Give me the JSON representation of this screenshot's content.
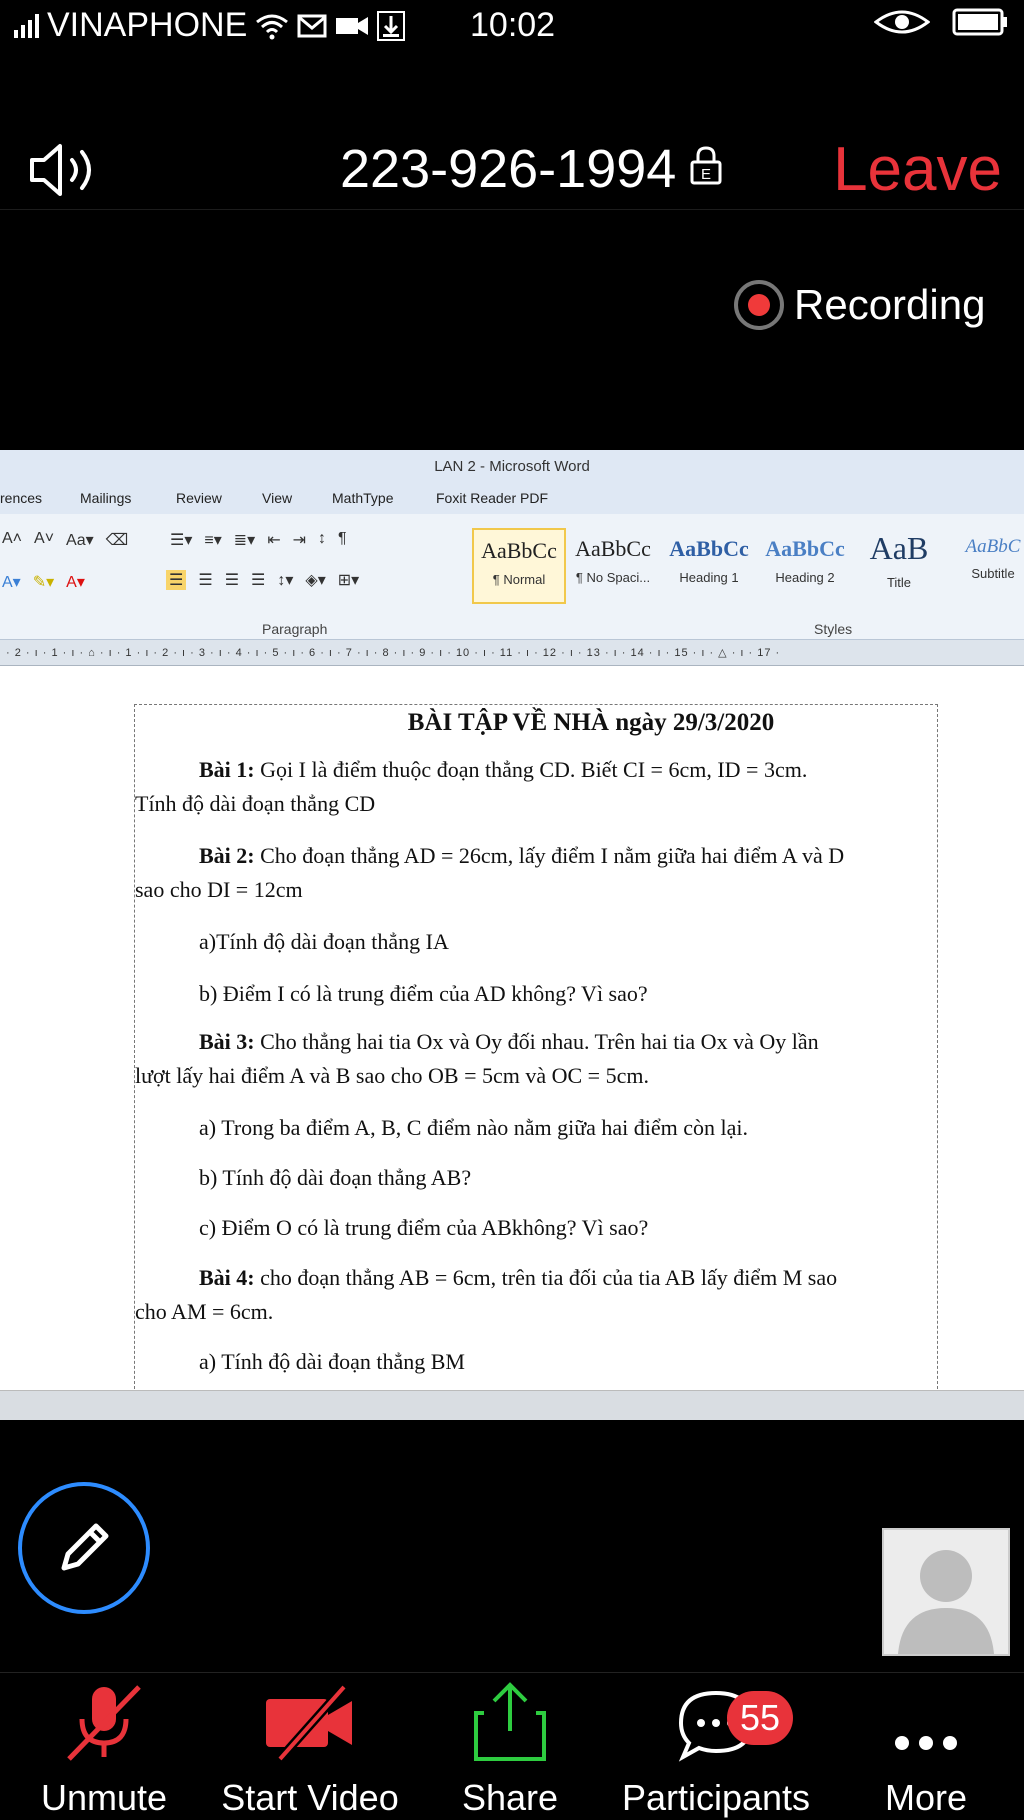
{
  "status_bar": {
    "carrier": "VINAPHONE",
    "time": "10:02",
    "icons": [
      "signal-icon",
      "wifi-icon",
      "mail-icon",
      "video-camera-icon",
      "download-icon",
      "eye-icon",
      "battery-icon"
    ]
  },
  "meeting": {
    "id": "223-926-1994",
    "lock_letter": "E",
    "leave_label": "Leave",
    "recording_label": "Recording",
    "colors": {
      "leave": "#e8333a",
      "record_dot": "#f03a3a",
      "annotate_ring": "#2d8cff",
      "share_green": "#2ecc40"
    }
  },
  "word": {
    "window_title": "LAN 2  -  Microsoft Word",
    "tabs": [
      "rences",
      "Mailings",
      "Review",
      "View",
      "MathType",
      "Foxit Reader PDF"
    ],
    "groups": {
      "paragraph": "Paragraph",
      "styles": "Styles"
    },
    "styles": [
      {
        "sample": "AaBbCc",
        "name": "¶ Normal"
      },
      {
        "sample": "AaBbCc",
        "name": "¶ No Spaci..."
      },
      {
        "sample": "AaBbCc",
        "name": "Heading 1"
      },
      {
        "sample": "AaBbCc",
        "name": "Heading 2"
      },
      {
        "sample": "AaB",
        "name": "Title"
      },
      {
        "sample": "AaBbC",
        "name": "Subtitle"
      }
    ],
    "ruler": "· 2 · ı · 1 · ı · ⌂ · ı · 1 · ı · 2 · ı · 3 · ı · 4 · ı · 5 · ı · 6 · ı · 7 · ı · 8 · ı · 9 · ı · 10 · ı · 11 · ı · 12 · ı · 13 · ı · 14 · ı · 15 · ı · △ · ı · 17 ·"
  },
  "document": {
    "title": "BÀI TẬP VỀ NHÀ ngày 29/3/2020",
    "b1_label": "Bài 1:",
    "b1_text": " Gọi I là điểm thuộc  đoạn thẳng CD. Biết CI = 6cm, ID = 3cm.",
    "b1_line2": "Tính độ dài đoạn thẳng CD",
    "b2_label": "Bài 2:",
    "b2_text": " Cho đoạn thẳng AD = 26cm, lấy điểm I nằm giữa hai điểm A và D",
    "b2_line2": "sao cho DI = 12cm",
    "b2_a": "a)Tính độ dài đoạn thẳng IA",
    "b2_b": "b) Điểm I có là trung điểm của AD không? Vì sao?",
    "b3_label": "Bài  3:",
    "b3_text": " Cho thẳng hai tia Ox  và Oy đối nhau. Trên  hai tia Ox  và Oy lần",
    "b3_line2": "lượt lấy hai điểm A và B  sao cho OB = 5cm và OC = 5cm.",
    "b3_a": "a) Trong ba điểm A, B, C điểm nào nằm giữa hai điểm còn lại.",
    "b3_b": "b) Tính độ dài đoạn thẳng AB?",
    "b3_c": "c) Điểm O có là trung điểm của ABkhông? Vì sao?",
    "b4_label": "Bài 4:",
    "b4_text": " cho đoạn thẳng AB = 6cm, trên tia đối của tia AB lấy điểm M sao",
    "b4_line2": "cho AM = 6cm.",
    "b4_a": "a)  Tính độ dài đoạn thẳng BM"
  },
  "toolbar": {
    "unmute": "Unmute",
    "start_video": "Start Video",
    "share": "Share",
    "participants": "Participants",
    "participants_count": "55",
    "more": "More"
  }
}
